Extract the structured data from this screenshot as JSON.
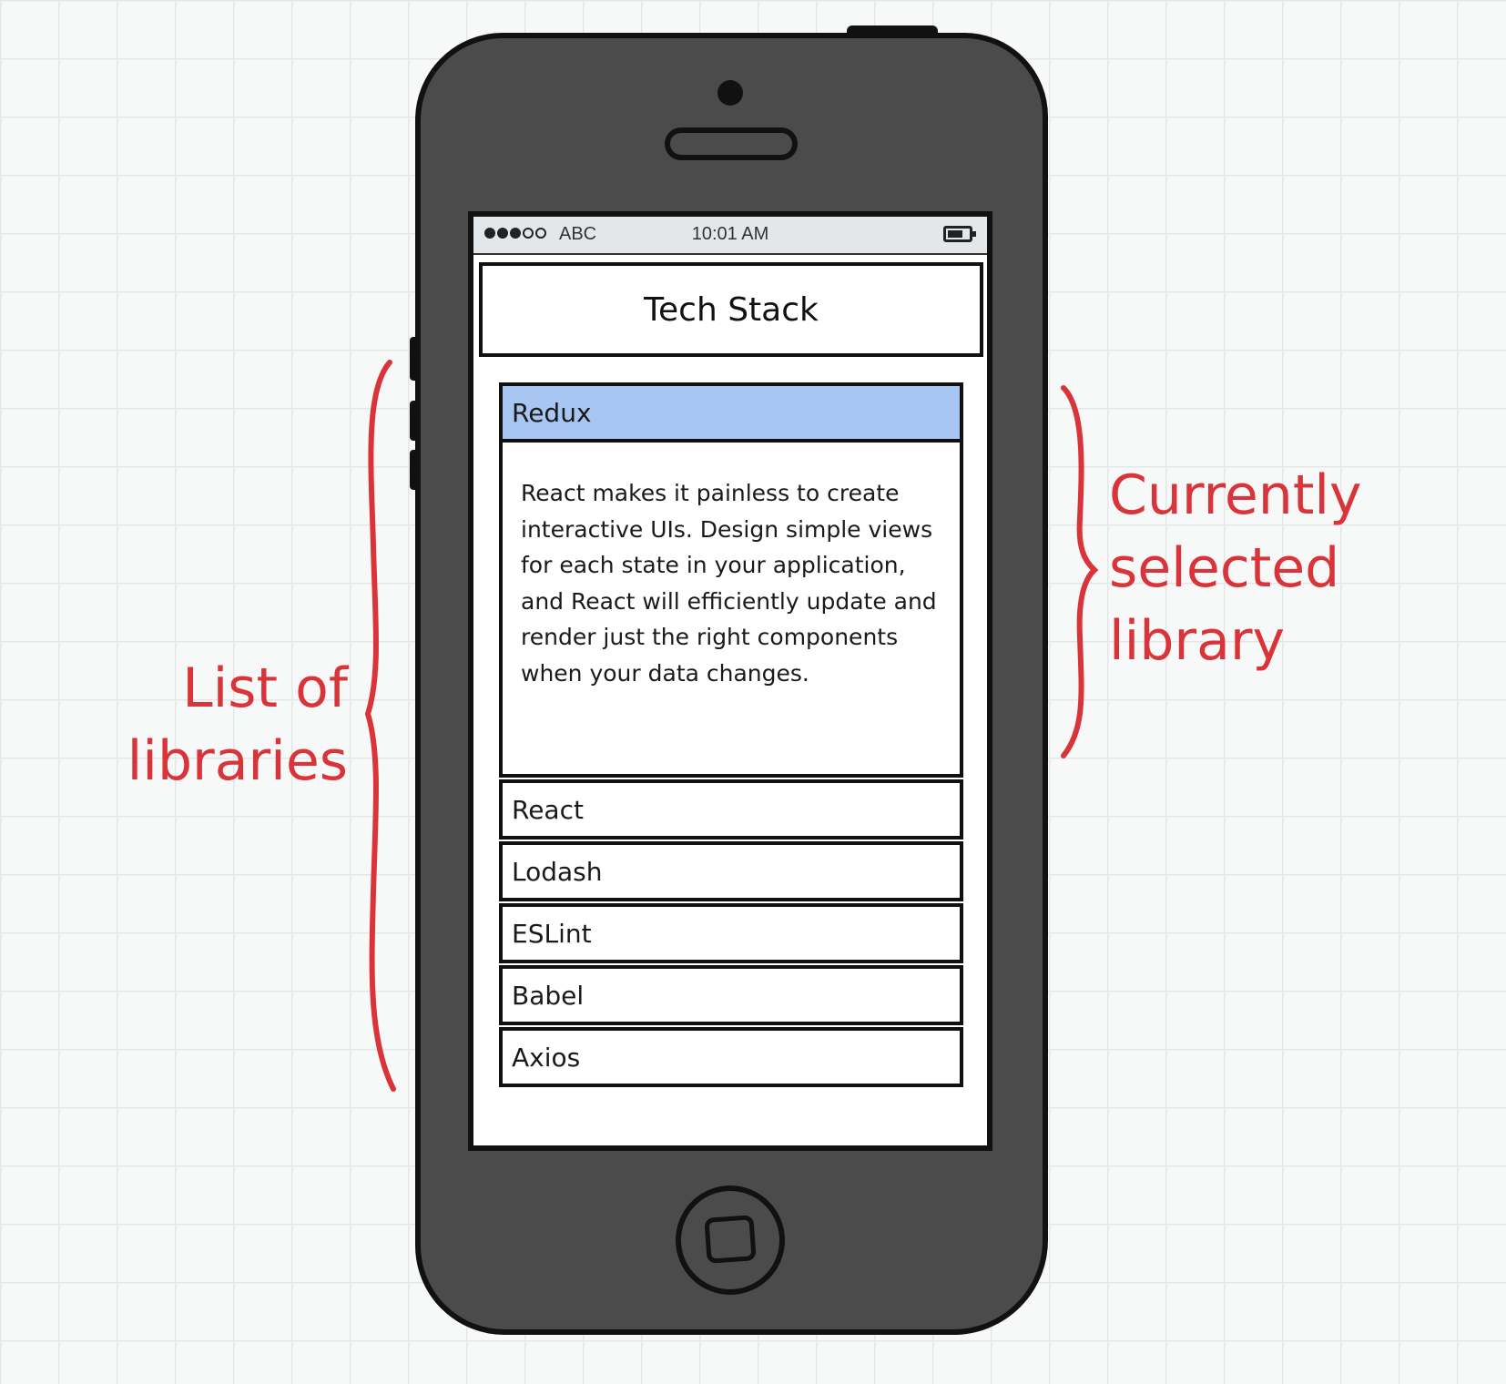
{
  "status_bar": {
    "carrier": "ABC",
    "time": "10:01 AM"
  },
  "header": {
    "title": "Tech Stack"
  },
  "library_list": {
    "selected": {
      "label": "Redux",
      "description": "React makes it painless to create interactive UIs. Design simple views for each state in your application, and React will efficiently update and render just the right components when your data changes."
    },
    "items": [
      {
        "label": "React"
      },
      {
        "label": "Lodash"
      },
      {
        "label": "ESLint"
      },
      {
        "label": "Babel"
      },
      {
        "label": "Axios"
      }
    ]
  },
  "annotations": {
    "left": "List of\nlibraries",
    "right": "Currently\nselected\nlibrary",
    "color": "#d9343a"
  },
  "colors": {
    "selected_row": "#a7c7f2",
    "phone_body": "#4b4b4b",
    "status_bar": "#e3e7ea"
  }
}
